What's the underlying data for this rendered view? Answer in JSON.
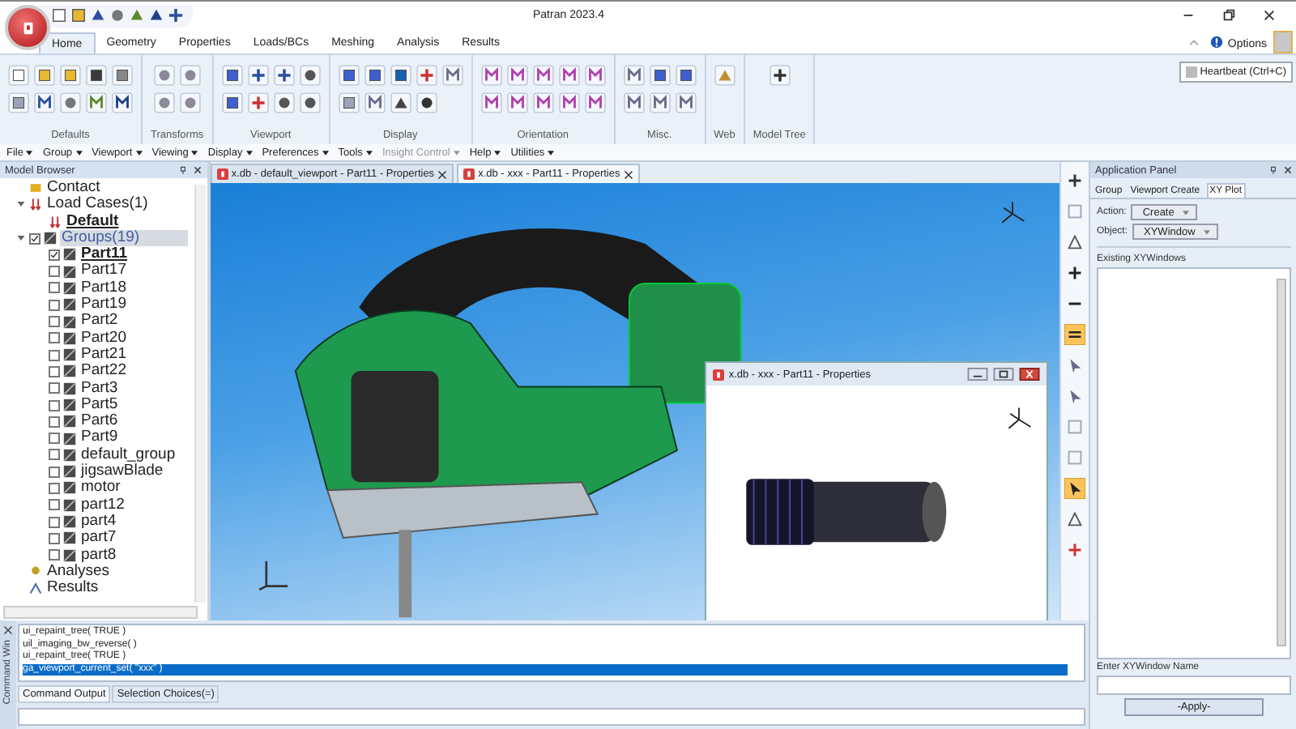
{
  "window": {
    "title": "Patran 2023.4"
  },
  "ribbon_tabs": [
    {
      "label": "Home",
      "selected": true
    },
    {
      "label": "Geometry",
      "selected": false
    },
    {
      "label": "Properties",
      "selected": false
    },
    {
      "label": "Loads/BCs",
      "selected": false
    },
    {
      "label": "Meshing",
      "selected": false
    },
    {
      "label": "Analysis",
      "selected": false
    },
    {
      "label": "Results",
      "selected": false
    }
  ],
  "options": {
    "label": "Options"
  },
  "ribbon_groups": [
    {
      "label": "Defaults"
    },
    {
      "label": "Transforms"
    },
    {
      "label": "Viewport"
    },
    {
      "label": "Display"
    },
    {
      "label": "Orientation"
    },
    {
      "label": "Misc."
    },
    {
      "label": "Web"
    },
    {
      "label": "Model Tree"
    }
  ],
  "heartbeat": {
    "label": "Heartbeat (Ctrl+C)"
  },
  "menu": [
    {
      "label": "File",
      "disabled": false
    },
    {
      "label": "Group",
      "disabled": false
    },
    {
      "label": "Viewport",
      "disabled": false
    },
    {
      "label": "Viewing",
      "disabled": false
    },
    {
      "label": "Display",
      "disabled": false
    },
    {
      "label": "Preferences",
      "disabled": false
    },
    {
      "label": "Tools",
      "disabled": false
    },
    {
      "label": "Insight Control",
      "disabled": true
    },
    {
      "label": "Help",
      "disabled": false
    },
    {
      "label": "Utilities",
      "disabled": false
    }
  ],
  "model_browser": {
    "title": "Model Browser",
    "items": [
      {
        "label": "Contact",
        "kind": "contact",
        "selected": false
      },
      {
        "label": "Load Cases(1)",
        "kind": "loadcase",
        "expanded": true,
        "selected": false,
        "children": [
          {
            "label": "Default",
            "kind": "loadcase",
            "current": true,
            "selected": false
          }
        ]
      },
      {
        "label": "Groups(19)",
        "kind": "group",
        "expanded": true,
        "checked": true,
        "selected": true,
        "children": [
          {
            "label": "Part11",
            "kind": "group",
            "checked": true,
            "current": true,
            "selected": false
          },
          {
            "label": "Part17",
            "kind": "group",
            "checked": false,
            "selected": false
          },
          {
            "label": "Part18",
            "kind": "group",
            "checked": false,
            "selected": false
          },
          {
            "label": "Part19",
            "kind": "group",
            "checked": false,
            "selected": false
          },
          {
            "label": "Part2",
            "kind": "group",
            "checked": false,
            "selected": false
          },
          {
            "label": "Part20",
            "kind": "group",
            "checked": false,
            "selected": false
          },
          {
            "label": "Part21",
            "kind": "group",
            "checked": false,
            "selected": false
          },
          {
            "label": "Part22",
            "kind": "group",
            "checked": false,
            "selected": false
          },
          {
            "label": "Part3",
            "kind": "group",
            "checked": false,
            "selected": false
          },
          {
            "label": "Part5",
            "kind": "group",
            "checked": false,
            "selected": false
          },
          {
            "label": "Part6",
            "kind": "group",
            "checked": false,
            "selected": false
          },
          {
            "label": "Part9",
            "kind": "group",
            "checked": false,
            "selected": false
          },
          {
            "label": "default_group",
            "kind": "group",
            "checked": false,
            "selected": false
          },
          {
            "label": "jigsawBlade",
            "kind": "group",
            "checked": false,
            "selected": false
          },
          {
            "label": "motor",
            "kind": "group",
            "checked": false,
            "selected": false
          },
          {
            "label": "part12",
            "kind": "group",
            "checked": false,
            "selected": false
          },
          {
            "label": "part4",
            "kind": "group",
            "checked": false,
            "selected": false
          },
          {
            "label": "part7",
            "kind": "group",
            "checked": false,
            "selected": false
          },
          {
            "label": "part8",
            "kind": "group",
            "checked": false,
            "selected": false
          }
        ]
      },
      {
        "label": "Analyses",
        "kind": "analysis",
        "selected": false
      },
      {
        "label": "Results",
        "kind": "result",
        "selected": false
      }
    ]
  },
  "viewport_tabs": [
    {
      "label": "x.db - default_viewport - Part11 - Properties",
      "selected": false
    },
    {
      "label": "x.db - xxx - Part11 - Properties",
      "selected": true
    }
  ],
  "properties_window": {
    "title": "x.db - xxx - Part11 - Properties"
  },
  "view_toolbar": [
    {
      "active": false
    },
    {
      "active": false
    },
    {
      "active": false
    },
    {
      "active": false
    },
    {
      "active": false
    },
    {
      "active": true
    },
    {
      "active": false
    },
    {
      "active": false
    },
    {
      "active": false
    },
    {
      "active": false
    },
    {
      "active": true
    },
    {
      "active": false
    },
    {
      "active": false
    }
  ],
  "command": {
    "side_label": "Command Win",
    "lines": [
      {
        "text": "ui_repaint_tree( TRUE )",
        "selected": false
      },
      {
        "text": "uil_imaging_bw_reverse( )",
        "selected": false
      },
      {
        "text": "ui_repaint_tree( TRUE )",
        "selected": false
      },
      {
        "text": "ga_viewport_current_set( \"xxx\" )",
        "selected": true
      }
    ],
    "tabs": [
      {
        "label": "Command Output",
        "selected": true
      },
      {
        "label": "Selection Choices(=)",
        "selected": false
      }
    ]
  },
  "application_panel": {
    "title": "Application Panel",
    "tabs": [
      {
        "label": "Group",
        "selected": false
      },
      {
        "label": "Viewport Create",
        "selected": false
      },
      {
        "label": "XY Plot",
        "selected": true
      }
    ],
    "action": {
      "label": "Action:",
      "value": "Create"
    },
    "object": {
      "label": "Object:",
      "value": "XYWindow"
    },
    "list_label": "Existing XYWindows",
    "name_label": "Enter XYWindow Name",
    "apply": "-Apply-"
  }
}
